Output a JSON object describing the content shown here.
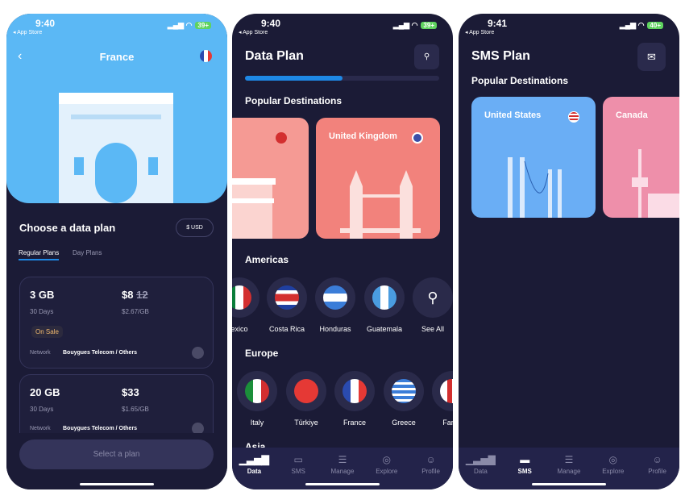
{
  "phone1": {
    "time": "9:40",
    "back": "App Store",
    "battery": "39+",
    "title": "France",
    "heading": "Choose a data plan",
    "currency": "$ USD",
    "tabs": [
      "Regular Plans",
      "Day Plans"
    ],
    "plans": [
      {
        "size": "3 GB",
        "days": "30 Days",
        "price": "$8",
        "old_price": "12",
        "per_gb": "$2.67/GB",
        "badge": "On Sale",
        "network_label": "Network",
        "network": "Bouygues Telecom / Others"
      },
      {
        "size": "20 GB",
        "days": "30 Days",
        "price": "$33",
        "per_gb": "$1.65/GB",
        "network_label": "Network",
        "network": "Bouygues Telecom / Others"
      }
    ],
    "cta": "Select a plan"
  },
  "phone2": {
    "time": "9:40",
    "back": "App Store",
    "battery": "39+",
    "title": "Data Plan",
    "popular": "Popular Destinations",
    "destinations": [
      "United Kingdom"
    ],
    "americas": "Americas",
    "americas_items": [
      "exico",
      "Costa Rica",
      "Honduras",
      "Guatemala",
      "See All"
    ],
    "europe": "Europe",
    "europe_items": [
      "Italy",
      "Türkiye",
      "France",
      "Greece",
      "Faroe"
    ],
    "asia": "Asia"
  },
  "phone3": {
    "time": "9:41",
    "back": "App Store",
    "battery": "40+",
    "title": "SMS Plan",
    "popular": "Popular Destinations",
    "destinations": [
      "United States",
      "Canada"
    ]
  },
  "tabbar": [
    "Data",
    "SMS",
    "Manage",
    "Explore",
    "Profile"
  ],
  "colors": {
    "bg": "#1b1b36",
    "sky": "#5bb8f5",
    "salmon": "#f2827c",
    "accent": "#1e88e5",
    "sale": "#f0b86e"
  }
}
